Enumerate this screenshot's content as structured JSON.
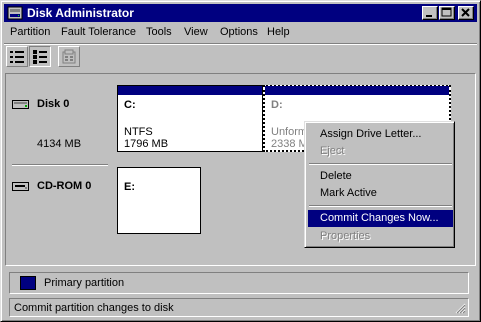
{
  "window": {
    "title": "Disk Administrator",
    "title_bar_color": "#000080"
  },
  "menubar": {
    "items": [
      {
        "label": "Partition"
      },
      {
        "label": "Fault Tolerance"
      },
      {
        "label": "Tools"
      },
      {
        "label": "View"
      },
      {
        "label": "Options"
      },
      {
        "label": "Help"
      }
    ]
  },
  "toolbar": {
    "buttons": [
      {
        "icon": "volumes-view-icon",
        "pressed": false
      },
      {
        "icon": "disk-configuration-view-icon",
        "pressed": true
      },
      {
        "icon": "properties-icon",
        "pressed": false,
        "enabled": false
      }
    ]
  },
  "disks": [
    {
      "label": "Disk 0",
      "size": "4134 MB",
      "icon": "hard-disk-icon",
      "partitions": [
        {
          "letter": "C:",
          "filesystem": "NTFS",
          "size": "1796 MB",
          "type": "primary"
        },
        {
          "letter": "D:",
          "filesystem": "Unform",
          "size": "2338 M",
          "type": "primary",
          "selected": true
        }
      ]
    },
    {
      "label": "CD-ROM 0",
      "size": "",
      "icon": "cd-rom-icon",
      "partitions": [
        {
          "letter": "E:",
          "filesystem": "",
          "size": ""
        }
      ]
    }
  ],
  "context_menu": {
    "items": [
      {
        "label": "Assign Drive Letter...",
        "enabled": true
      },
      {
        "label": "Eject",
        "enabled": false
      },
      {
        "label": "Delete",
        "enabled": true
      },
      {
        "label": "Mark Active",
        "enabled": true
      },
      {
        "label": "Commit Changes Now...",
        "enabled": true,
        "highlighted": true
      },
      {
        "label": "Properties",
        "enabled": false
      }
    ]
  },
  "legend": {
    "items": [
      {
        "label": "Primary partition",
        "color": "#000080"
      }
    ]
  },
  "statusbar": {
    "text": "Commit partition changes to disk"
  }
}
